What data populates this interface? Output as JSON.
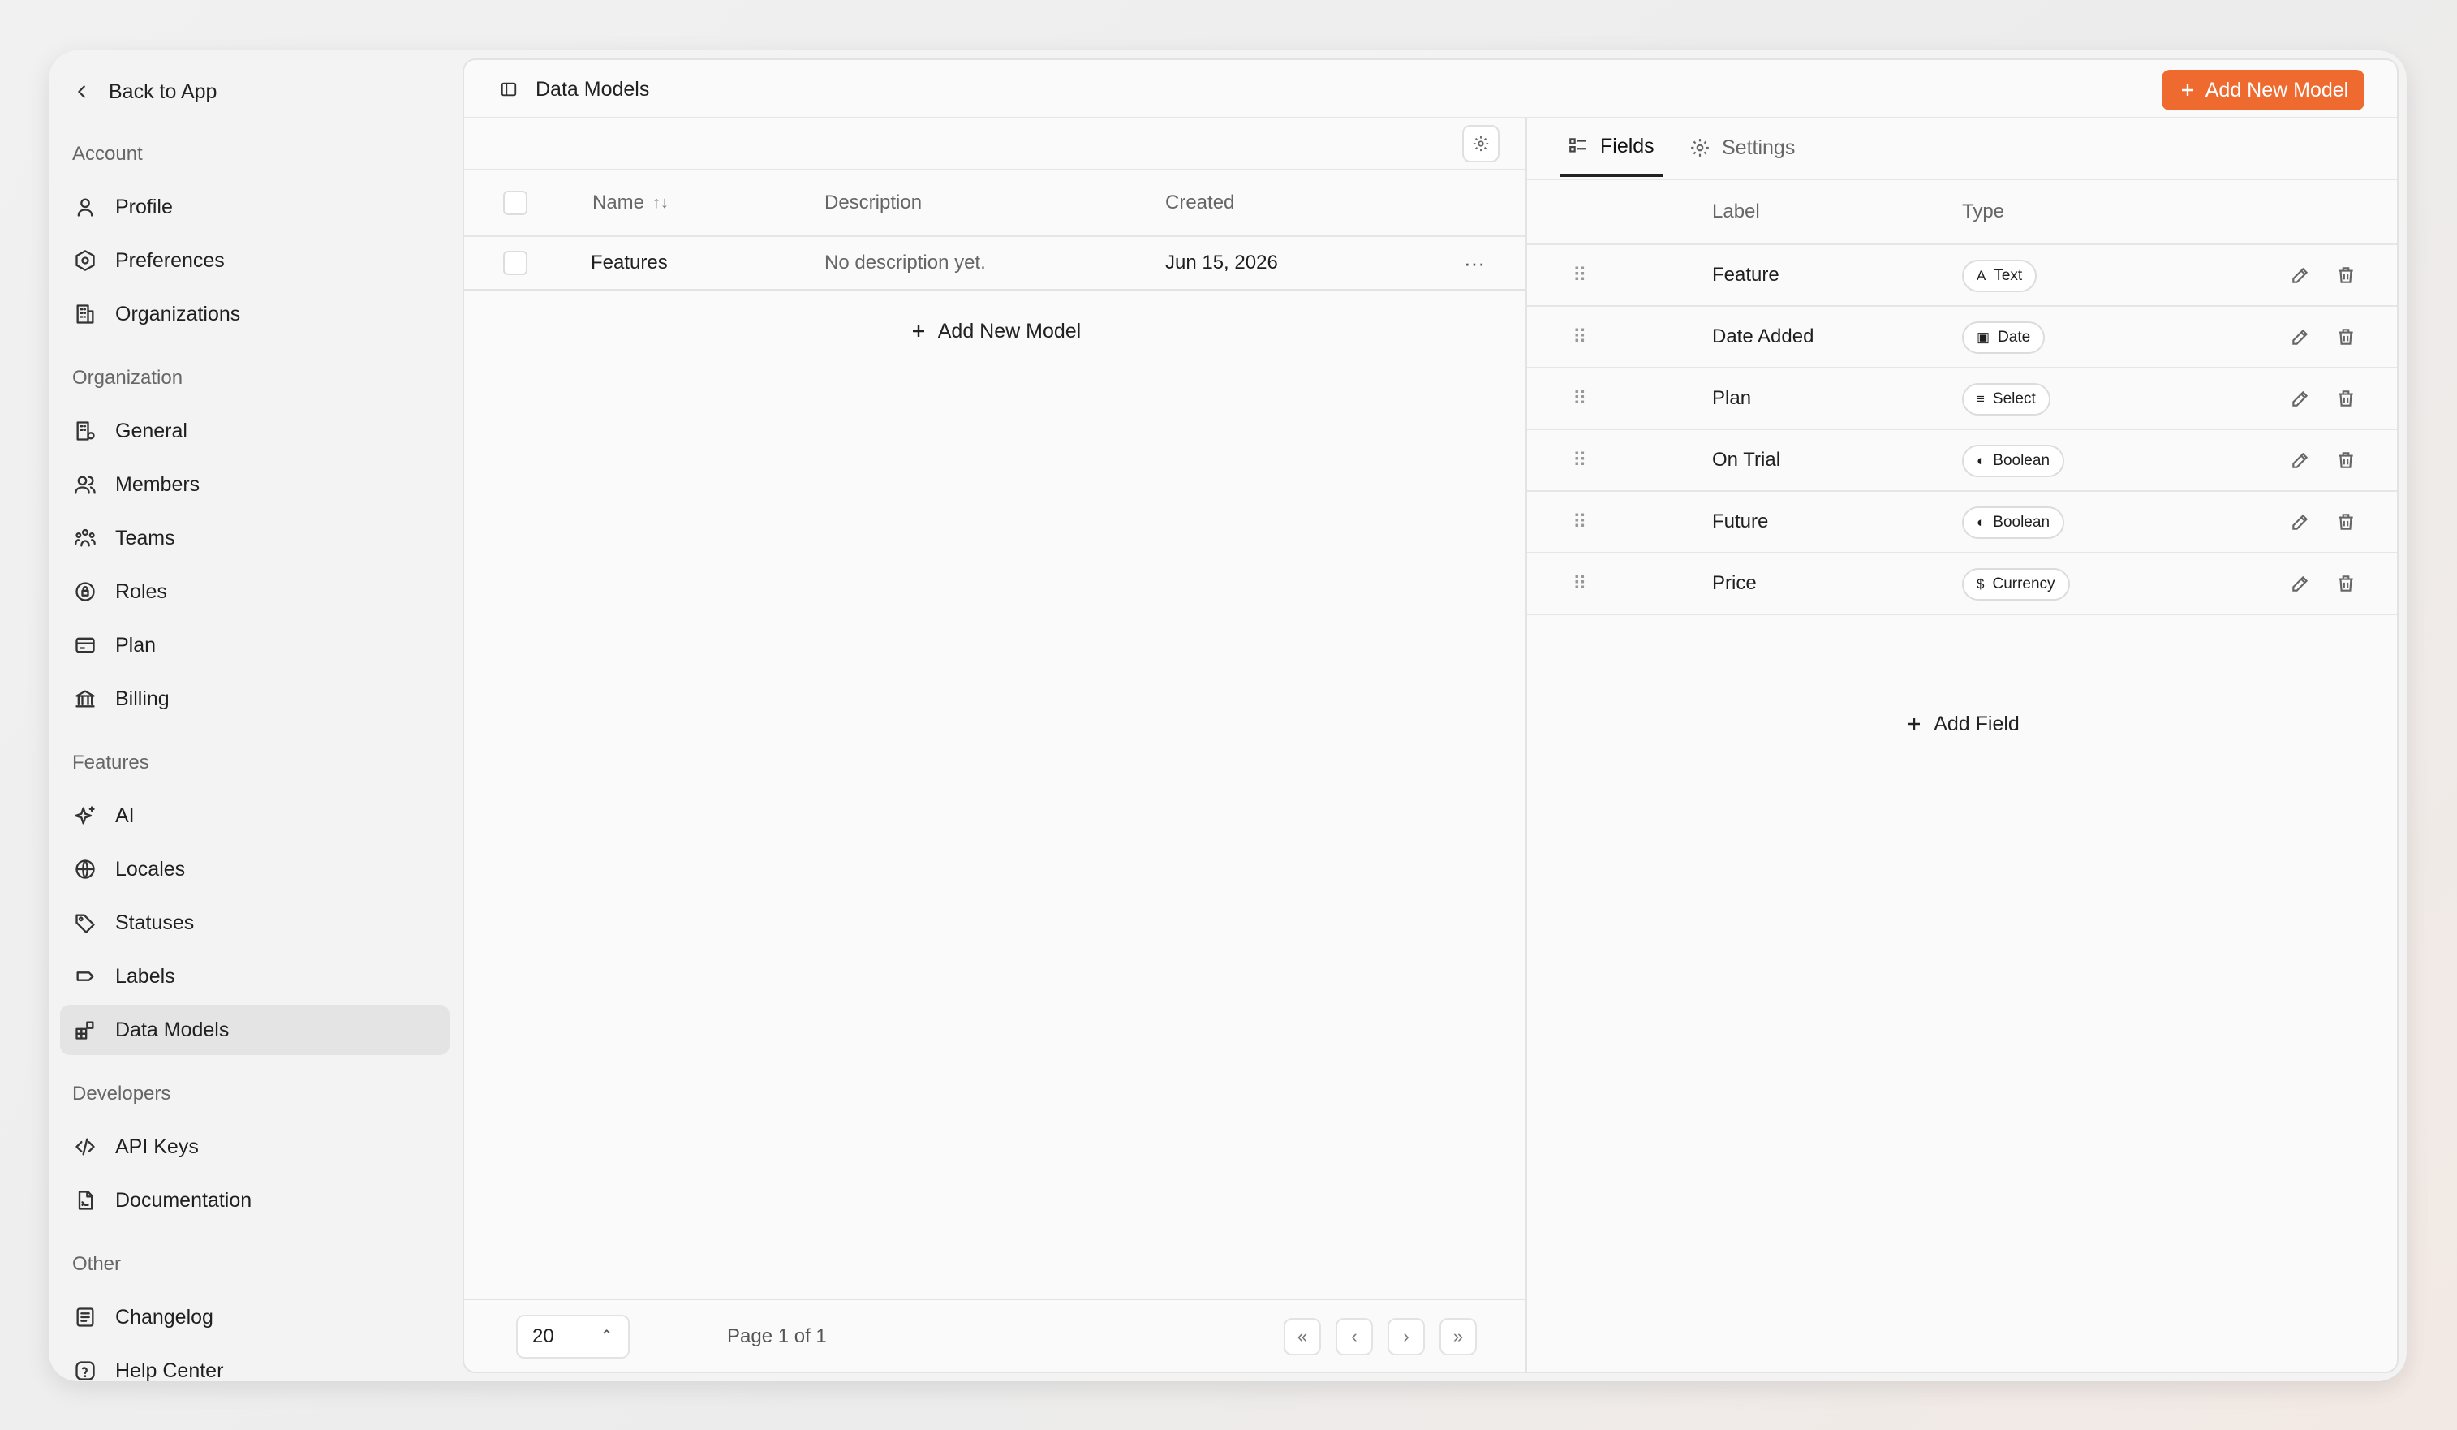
{
  "sidebar": {
    "back_label": "Back to App",
    "sections": [
      {
        "title": "Account",
        "items": [
          {
            "label": "Profile",
            "icon": "user-icon"
          },
          {
            "label": "Preferences",
            "icon": "hexagon-settings-icon"
          },
          {
            "label": "Organizations",
            "icon": "building-icon"
          }
        ]
      },
      {
        "title": "Organization",
        "items": [
          {
            "label": "General",
            "icon": "building-gear-icon"
          },
          {
            "label": "Members",
            "icon": "users-icon"
          },
          {
            "label": "Teams",
            "icon": "team-icon"
          },
          {
            "label": "Roles",
            "icon": "role-badge-icon"
          },
          {
            "label": "Plan",
            "icon": "card-icon"
          },
          {
            "label": "Billing",
            "icon": "bank-icon"
          }
        ]
      },
      {
        "title": "Features",
        "items": [
          {
            "label": "AI",
            "icon": "sparkles-icon"
          },
          {
            "label": "Locales",
            "icon": "globe-icon"
          },
          {
            "label": "Statuses",
            "icon": "tag-icon"
          },
          {
            "label": "Labels",
            "icon": "label-icon"
          },
          {
            "label": "Data Models",
            "icon": "blocks-icon",
            "active": true
          }
        ]
      },
      {
        "title": "Developers",
        "items": [
          {
            "label": "API Keys",
            "icon": "code-icon"
          },
          {
            "label": "Documentation",
            "icon": "document-icon"
          }
        ]
      },
      {
        "title": "Other",
        "items": [
          {
            "label": "Changelog",
            "icon": "list-icon"
          },
          {
            "label": "Help Center",
            "icon": "help-icon"
          }
        ]
      }
    ]
  },
  "header": {
    "title": "Data Models",
    "add_button": "Add New Model"
  },
  "models_table": {
    "columns": {
      "name": "Name",
      "description": "Description",
      "created": "Created"
    },
    "rows": [
      {
        "name": "Features",
        "description": "No description yet.",
        "created": "Jun 15, 2026",
        "menu": "···"
      }
    ],
    "add_label": "Add New Model",
    "page_size": "20",
    "page_label": "Page 1 of 1"
  },
  "fields_panel": {
    "tabs": [
      {
        "label": "Fields",
        "active": true
      },
      {
        "label": "Settings",
        "active": false
      }
    ],
    "columns": {
      "label": "Label",
      "type": "Type"
    },
    "fields": [
      {
        "label": "Feature",
        "type": "Text",
        "type_icon": "A"
      },
      {
        "label": "Date Added",
        "type": "Date",
        "type_icon": "▣"
      },
      {
        "label": "Plan",
        "type": "Select",
        "type_icon": "≡"
      },
      {
        "label": "On Trial",
        "type": "Boolean",
        "type_icon": "◐"
      },
      {
        "label": "Future",
        "type": "Boolean",
        "type_icon": "◐"
      },
      {
        "label": "Price",
        "type": "Currency",
        "type_icon": "$"
      }
    ],
    "add_label": "Add Field"
  },
  "colors": {
    "accent": "#ef6a2e",
    "active_nav": "#e4e4e4"
  }
}
